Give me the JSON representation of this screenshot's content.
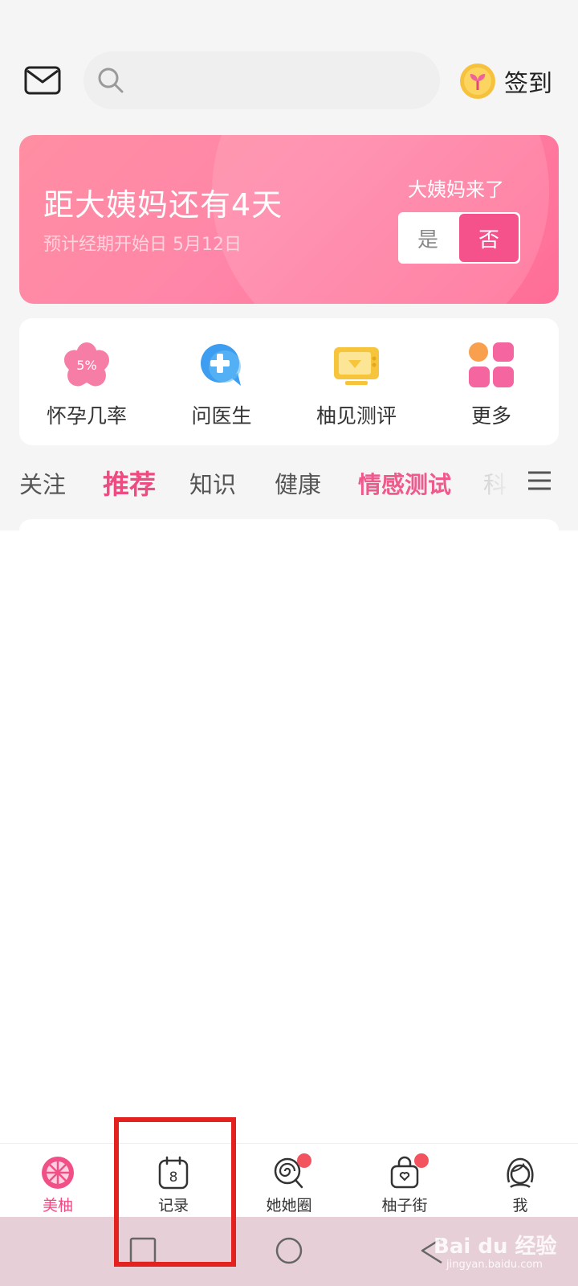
{
  "header": {
    "search": {
      "placeholder": ""
    },
    "signin_label": "签到"
  },
  "period_card": {
    "title": "距大姨妈还有4天",
    "subtitle": "预计经期开始日 5月12日",
    "arrived_label": "大姨妈来了",
    "toggle": {
      "yes": "是",
      "no": "否",
      "selected": "否"
    },
    "accent": "#f5518a"
  },
  "tools": [
    {
      "label": "怀孕几率",
      "icon": "flower-percent-icon",
      "badge": "5%"
    },
    {
      "label": "问医生",
      "icon": "doctor-chat-icon"
    },
    {
      "label": "柚见测评",
      "icon": "tv-review-icon"
    },
    {
      "label": "更多",
      "icon": "grid-more-icon"
    }
  ],
  "tabs": [
    "关注",
    "推荐",
    "知识",
    "健康",
    "情感测试",
    "科"
  ],
  "active_tab": "推荐",
  "bottom_nav": [
    {
      "label": "美柚",
      "icon": "meiyou-grapefruit-icon",
      "active": true
    },
    {
      "label": "记录",
      "icon": "calendar-record-icon",
      "calendar_day": "8"
    },
    {
      "label": "她她圈",
      "icon": "swirl-lollipop-icon",
      "dot": true
    },
    {
      "label": "柚子街",
      "icon": "shopping-bag-icon",
      "dot": true
    },
    {
      "label": "我",
      "icon": "user-face-icon"
    }
  ],
  "colors": {
    "brand_pink": "#ee4b80",
    "highlight_red": "#e3211f",
    "notification_dot": "#f2535e"
  },
  "watermark": {
    "brand": "Bai du 经验",
    "url": "jingyan.baidu.com"
  }
}
